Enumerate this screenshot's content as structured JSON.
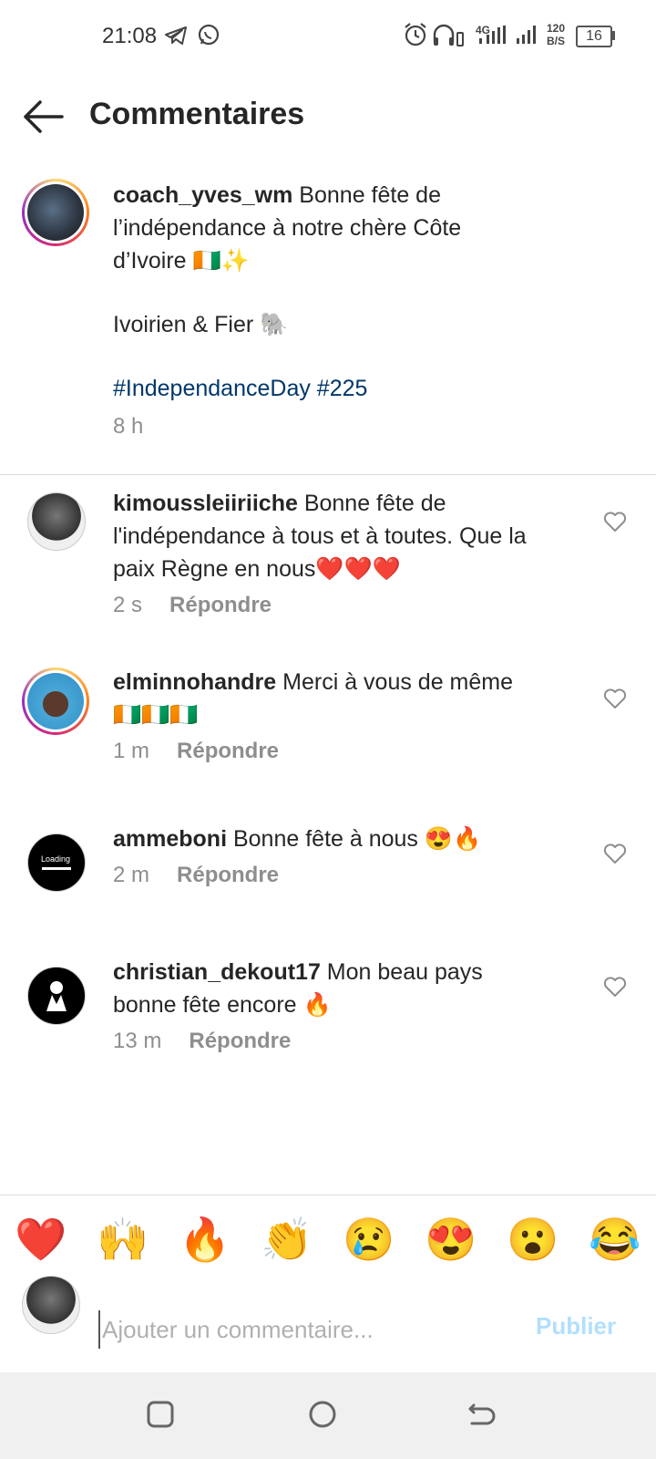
{
  "status_bar": {
    "time": "21:08",
    "network": "4G",
    "speed_top": "120",
    "speed_bottom": "B/S",
    "battery": "16",
    "icons": [
      "telegram-icon",
      "whatsapp-icon",
      "alarm-icon",
      "headphones-icon",
      "signal-icon",
      "battery-icon"
    ]
  },
  "header": {
    "title": "Commentaires",
    "back_icon": "arrow-left-icon"
  },
  "caption": {
    "username": "coach_yves_wm",
    "line1": " Bonne fête de",
    "line2": "l’indépendance à notre chère Côte",
    "line3": "d’Ivoire 🇨🇮✨",
    "line4": "Ivoirien & Fier 🐘",
    "hashtags": "#IndependanceDay #225",
    "time": "8 h"
  },
  "comments": [
    {
      "username": "kimoussleiiriiche",
      "lines": [
        " Bonne fête de",
        "l'indépendance à tous et à toutes. Que la",
        "paix Règne en nous❤️❤️❤️"
      ],
      "time": "2 s",
      "reply": "Répondre"
    },
    {
      "username": "elminnohandre",
      "lines": [
        " Merci à vous de même",
        "🇨🇮🇨🇮🇨🇮"
      ],
      "time": "1 m",
      "reply": "Répondre"
    },
    {
      "username": "ammeboni",
      "lines": [
        " Bonne fête à nous 😍🔥"
      ],
      "time": "2 m",
      "reply": "Répondre",
      "avatar_text": "Loading"
    },
    {
      "username": "christian_dekout17",
      "lines": [
        " Mon beau pays",
        "bonne fête encore 🔥"
      ],
      "time": "13 m",
      "reply": "Répondre"
    }
  ],
  "reactions": [
    "❤️",
    "🙌",
    "🔥",
    "👏",
    "😢",
    "😍",
    "😮",
    "😂"
  ],
  "composer": {
    "placeholder": "Ajouter un commentaire...",
    "publish": "Publier"
  },
  "nav": {
    "icons": [
      "recent-apps-icon",
      "home-icon",
      "back-icon"
    ]
  }
}
